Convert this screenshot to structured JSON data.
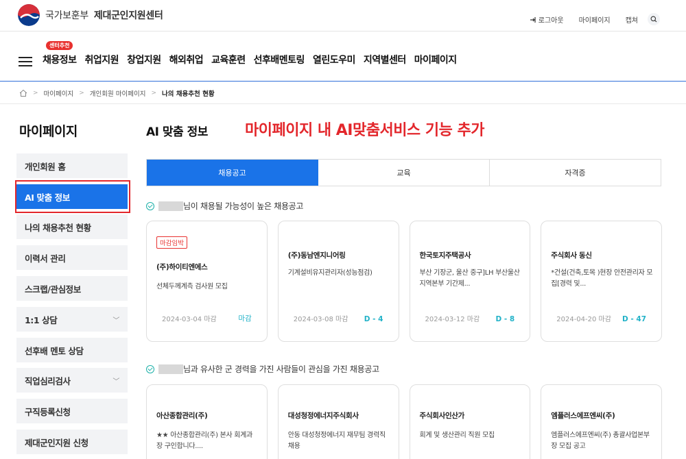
{
  "header": {
    "org_name": "국가보훈부",
    "center_name": "제대군인지원센터",
    "util_links": {
      "logout": "로그아웃",
      "mypage": "마이페이지",
      "capture": "캡쳐"
    }
  },
  "nav": {
    "badge": "센터추천",
    "menu": [
      "채용정보",
      "취업지원",
      "창업지원",
      "해외취업",
      "교육훈련",
      "선후배멘토링",
      "열린도우미",
      "지역별센터",
      "마이페이지"
    ]
  },
  "breadcrumb": [
    "마이페이지",
    "개인회원 마이페이지",
    "나의 채용추천 현황"
  ],
  "sidebar": {
    "title": "마이페이지",
    "items": [
      {
        "label": "개인회원 홈",
        "expandable": false,
        "active": false
      },
      {
        "label": "AI 맞춤 정보",
        "expandable": false,
        "active": true
      },
      {
        "label": "나의 채용추천 현황",
        "expandable": false,
        "active": false
      },
      {
        "label": "이력서 관리",
        "expandable": false,
        "active": false
      },
      {
        "label": "스크랩/관심정보",
        "expandable": false,
        "active": false
      },
      {
        "label": "1:1 상담",
        "expandable": true,
        "active": false
      },
      {
        "label": "선후배 멘토 상담",
        "expandable": false,
        "active": false
      },
      {
        "label": "직업심리검사",
        "expandable": true,
        "active": false
      },
      {
        "label": "구직등록신청",
        "expandable": false,
        "active": false
      },
      {
        "label": "제대군인지원 신청",
        "expandable": false,
        "active": false
      }
    ]
  },
  "main": {
    "title": "AI 맞춤 정보",
    "annotation": "마이페이지 내 AI맞춤서비스 기능 추가",
    "tabs": [
      {
        "label": "채용공고",
        "active": true
      },
      {
        "label": "교육",
        "active": false
      },
      {
        "label": "자격증",
        "active": false
      }
    ],
    "section1": {
      "title_suffix": "님이 채용될 가능성이 높은 채용공고",
      "cards": [
        {
          "tag": "마감임박",
          "company": "(주)하이티엔에스",
          "desc": "선체두께계측 검사원 모집",
          "date": "2024-03-04 마감",
          "dday": "마감"
        },
        {
          "tag": "",
          "company": "(주)동남엔지니어링",
          "desc": "기계설비유지관리자(성능점검)",
          "date": "2024-03-08 마감",
          "dday": "D - 4"
        },
        {
          "tag": "",
          "company": "한국토지주택공사",
          "desc": "부산 기장군, 울산 중구]LH 부산울산지역본부 기간제...",
          "date": "2024-03-12 마감",
          "dday": "D - 8"
        },
        {
          "tag": "",
          "company": "주식회사 동신",
          "desc": "*건설(건축,토목 )현장 안전관리자 모집[경력 및...",
          "date": "2024-04-20 마감",
          "dday": "D - 47"
        }
      ]
    },
    "section2": {
      "title_suffix": "님과 유사한 군 경력을 가진 사람들이 관심을 가진 채용공고",
      "cards": [
        {
          "company": "아산종합관리(주)",
          "desc": "★★ 아산종합관리(주) 본사 회계과장 구인합니다...."
        },
        {
          "company": "대성청정에너지주식회사",
          "desc": "안동 대성청정에너지 재무팀 경력직 채용"
        },
        {
          "company": "주식회사인산가",
          "desc": "회계 및 생산관리 직원 모집"
        },
        {
          "company": "엠플러스에프엔씨(주)",
          "desc": "엠플러스에프엔씨(주) 총괄사업본부장 모집 공고"
        }
      ]
    }
  },
  "colors": {
    "primary": "#1a73e8",
    "annotation_red": "#e3262b",
    "badge_red": "#e8312f",
    "dday_teal": "#22b2c8"
  }
}
